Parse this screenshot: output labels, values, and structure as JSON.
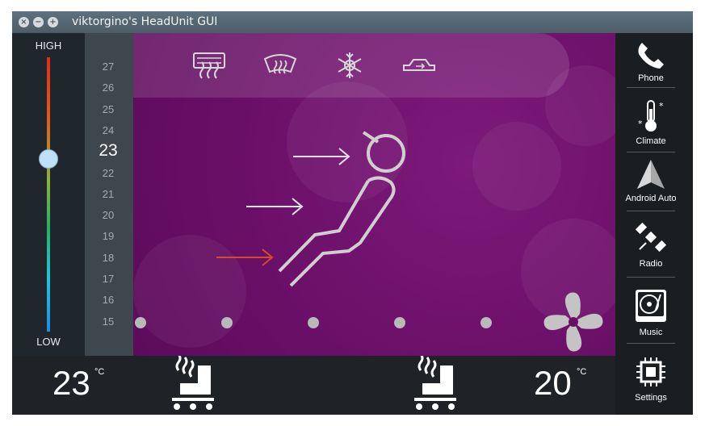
{
  "window": {
    "title": "viktorgino's HeadUnit GUI",
    "close_glyph": "×",
    "minimize_glyph": "−",
    "maximize_glyph": "+"
  },
  "fan_slider": {
    "high_label": "HIGH",
    "low_label": "LOW",
    "level": 0.63
  },
  "temp_scale": {
    "ticks": [
      "27",
      "26",
      "25",
      "24",
      "23",
      "22",
      "21",
      "20",
      "19",
      "18",
      "17",
      "16",
      "15"
    ],
    "current": "23"
  },
  "climate": {
    "top_icons": [
      "rear-defrost-icon",
      "windshield-defrost-icon",
      "ac-snowflake-icon",
      "air-recirculation-icon"
    ],
    "airflow": [
      "head-airflow-arrow",
      "body-airflow-arrow",
      "feet-airflow-arrow"
    ],
    "fan_speed_dots": 5
  },
  "bottom": {
    "left_temp": "23",
    "left_unit": "°C",
    "right_temp": "20",
    "right_unit": "°C"
  },
  "nav": {
    "items": [
      {
        "label": "Phone",
        "icon": "phone-icon"
      },
      {
        "label": "Climate",
        "icon": "thermometer-icon"
      },
      {
        "label": "Android Auto",
        "icon": "android-auto-icon"
      },
      {
        "label": "Radio",
        "icon": "satellite-icon"
      },
      {
        "label": "Music",
        "icon": "turntable-icon"
      },
      {
        "label": "Settings",
        "icon": "chip-icon"
      }
    ]
  },
  "colors": {
    "accent_purple": "#6a0f67",
    "airflow_active": "#d24b2a",
    "slider_handle": "#bfe1f7"
  }
}
